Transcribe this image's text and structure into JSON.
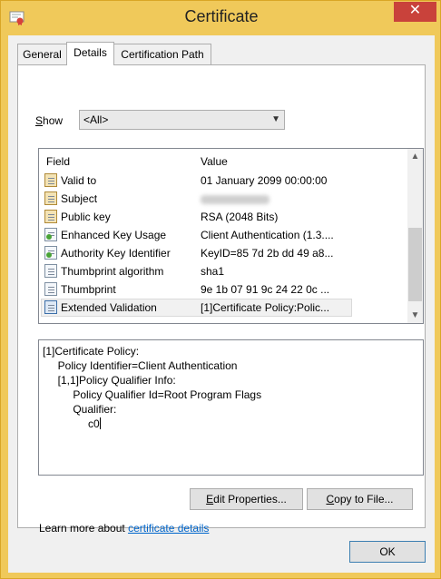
{
  "window": {
    "title": "Certificate",
    "close_glyph": "✕"
  },
  "tabs": [
    {
      "label": "General",
      "active": false
    },
    {
      "label": "Details",
      "active": true
    },
    {
      "label": "Certification Path",
      "active": false
    }
  ],
  "show": {
    "label_accel": "S",
    "label_rest": "how",
    "selected": "<All>"
  },
  "list": {
    "col_field": "Field",
    "col_value": "Value",
    "rows": [
      {
        "field": "Valid to",
        "value": "01 January 2099 00:00:00",
        "icon": "cert-field-icon"
      },
      {
        "field": "Subject",
        "value": "",
        "icon": "cert-field-icon",
        "value_redacted": true
      },
      {
        "field": "Public key",
        "value": "RSA (2048 Bits)",
        "icon": "cert-field-icon"
      },
      {
        "field": "Enhanced Key Usage",
        "value": "Client Authentication (1.3....",
        "icon": "extension-icon"
      },
      {
        "field": "Authority Key Identifier",
        "value": "KeyID=85 7d 2b dd 49 a8...",
        "icon": "extension-icon"
      },
      {
        "field": "Thumbprint algorithm",
        "value": "sha1",
        "icon": "property-icon"
      },
      {
        "field": "Thumbprint",
        "value": "9e 1b 07 91 9c 24 22 0c ...",
        "icon": "property-icon"
      },
      {
        "field": "Extended Validation",
        "value": "[1]Certificate Policy:Polic...",
        "icon": "property-icon",
        "selected": true
      }
    ]
  },
  "detail_lines": [
    "[1]Certificate Policy:",
    "     Policy Identifier=Client Authentication",
    "     [1,1]Policy Qualifier Info:",
    "          Policy Qualifier Id=Root Program Flags",
    "          Qualifier:",
    "               c0"
  ],
  "buttons": {
    "edit_accel": "E",
    "edit_rest": "dit Properties...",
    "copy_accel": "C",
    "copy_rest": "opy to File...",
    "ok": "OK"
  },
  "learn": {
    "prefix": "Learn more about ",
    "link": "certificate details"
  },
  "colors": {
    "frame": "#f0c95a",
    "close": "#c9423b",
    "link": "#0066cc"
  }
}
